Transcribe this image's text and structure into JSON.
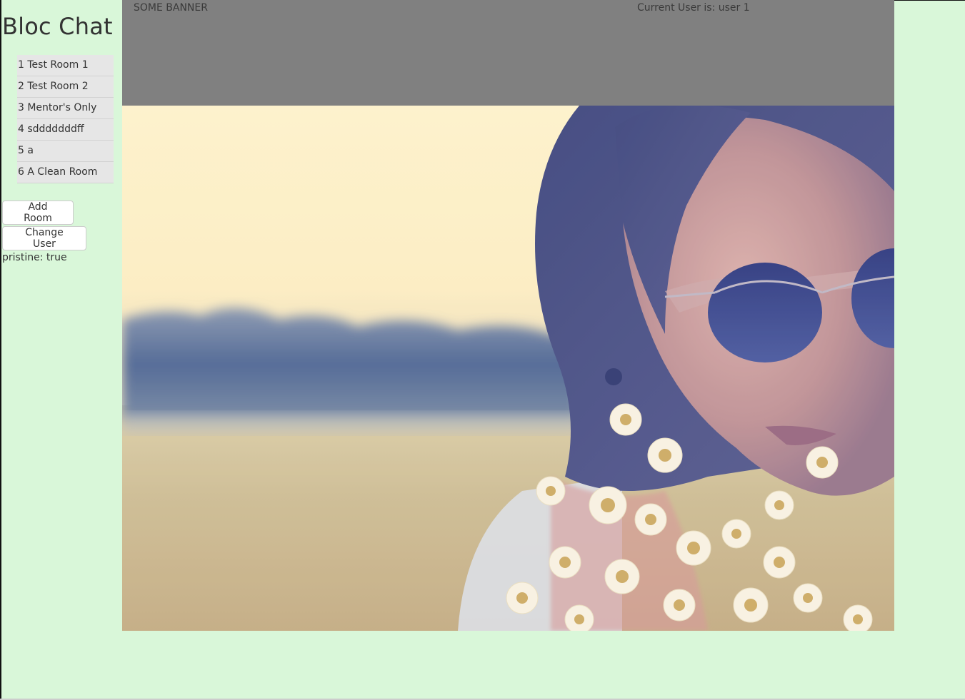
{
  "sidebar": {
    "title": "Bloc Chat",
    "rooms": [
      {
        "label": "1 Test Room 1"
      },
      {
        "label": "2 Test Room 2"
      },
      {
        "label": "3 Mentor's Only"
      },
      {
        "label": "4 sdddddddff"
      },
      {
        "label": "5 a"
      },
      {
        "label": "6 A Clean Room"
      }
    ],
    "add_room_label": "Add Room",
    "change_user_label": "Change User",
    "pristine_text": "pristine: true"
  },
  "banner": {
    "text": "SOME BANNER",
    "current_user_text": "Current User is: user 1"
  },
  "hero": {
    "subject": "woman-with-sunglasses-and-daisies-photo"
  },
  "colors": {
    "page_bg": "#d9f7d9",
    "banner_bg": "#808080",
    "room_bg": "#e6e6e6"
  }
}
